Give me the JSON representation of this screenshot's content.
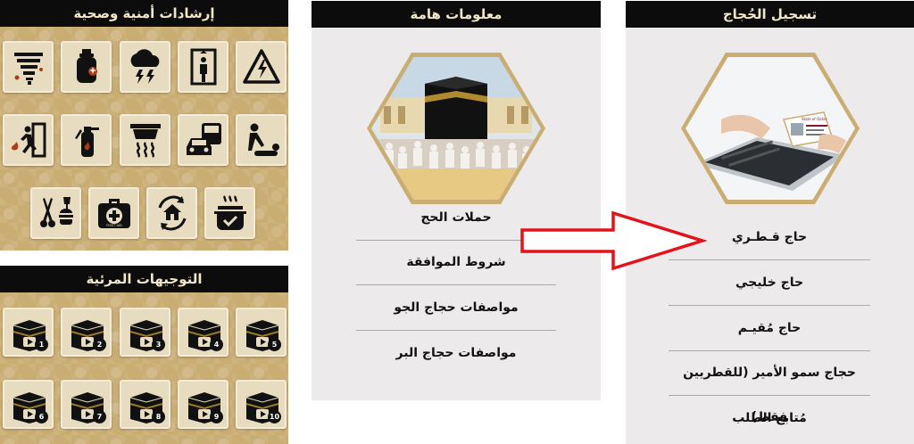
{
  "safety_panel": {
    "title": "إرشادات أمنية وصحية",
    "icons": [
      "tornado-icon",
      "gas-cylinder-icon",
      "storm-icon",
      "elevator-icon",
      "high-voltage-icon",
      "emergency-exit-icon",
      "fire-extinguisher-icon",
      "smoke-detector-icon",
      "vehicles-icon",
      "cpr-icon",
      "barber-food-icon",
      "first-aid-kit-icon",
      "house-care-icon",
      "cooking-pot-icon"
    ],
    "first_aid_text": "FIRST AID"
  },
  "video_panel": {
    "title": "التوجيهات المرئية",
    "videos": [
      "1",
      "2",
      "3",
      "4",
      "5",
      "6",
      "7",
      "8",
      "9",
      "10"
    ]
  },
  "info_panel": {
    "title": "معلومات هامة",
    "image": "kaaba-image",
    "items": [
      "حملات الحج",
      "شروط الموافقة",
      "مواصفات حجاج الجو",
      "مواصفات حجاج البر"
    ]
  },
  "registration_panel": {
    "title": "تسجيل الحُجاج",
    "image": "laptop-id-card-image",
    "id_card_text": "State of Qatar",
    "items": [
      "حاج قـطـري",
      "حاج خليجي",
      "حاج مُقيـم",
      "حجاج سمو الأمير (للقطريين فقط)",
      "مُتابع الطلب"
    ]
  },
  "arrow": {
    "color": "#e3131b"
  }
}
